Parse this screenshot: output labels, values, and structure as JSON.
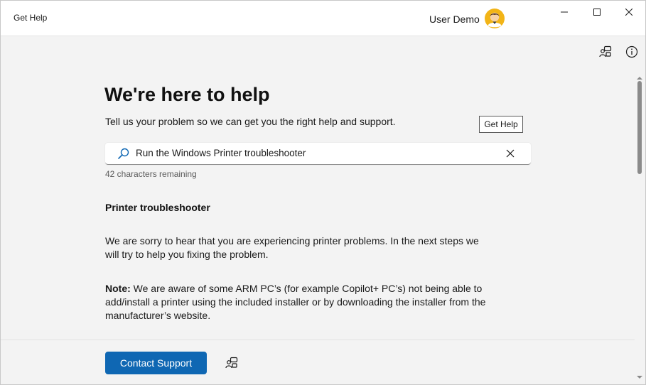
{
  "titlebar": {
    "app_title": "Get Help",
    "user_name": "User Demo"
  },
  "window_controls": {
    "minimize_icon": "minimize-icon",
    "maximize_icon": "maximize-icon",
    "close_icon": "close-icon"
  },
  "toolbar": {
    "community_icon": "community-icon",
    "info_icon": "info-icon"
  },
  "main": {
    "heading": "We're here to help",
    "subtitle": "Tell us your problem so we can get you the right help and support.",
    "tooltip": "Get Help",
    "search": {
      "value": "Run the Windows Printer troubleshooter",
      "icon": "search-icon",
      "clear_icon": "clear-icon"
    },
    "chars_remaining": "42 characters remaining",
    "section_title": "Printer troubleshooter",
    "paragraph1": "We are sorry to hear that you are experiencing printer problems. In the next steps we will try to help you fixing the problem.",
    "note_label": "Note:",
    "note_text": " We are aware of some ARM PC’s (for example Copilot+ PC’s) not being able to add/install a printer using the included installer or by downloading the installer from the manufacturer’s website."
  },
  "footer": {
    "contact_button": "Contact Support",
    "community_icon": "community-icon"
  },
  "colors": {
    "accent": "#0f67b3",
    "background": "#f3f3f3",
    "titlebar": "#ffffff"
  }
}
